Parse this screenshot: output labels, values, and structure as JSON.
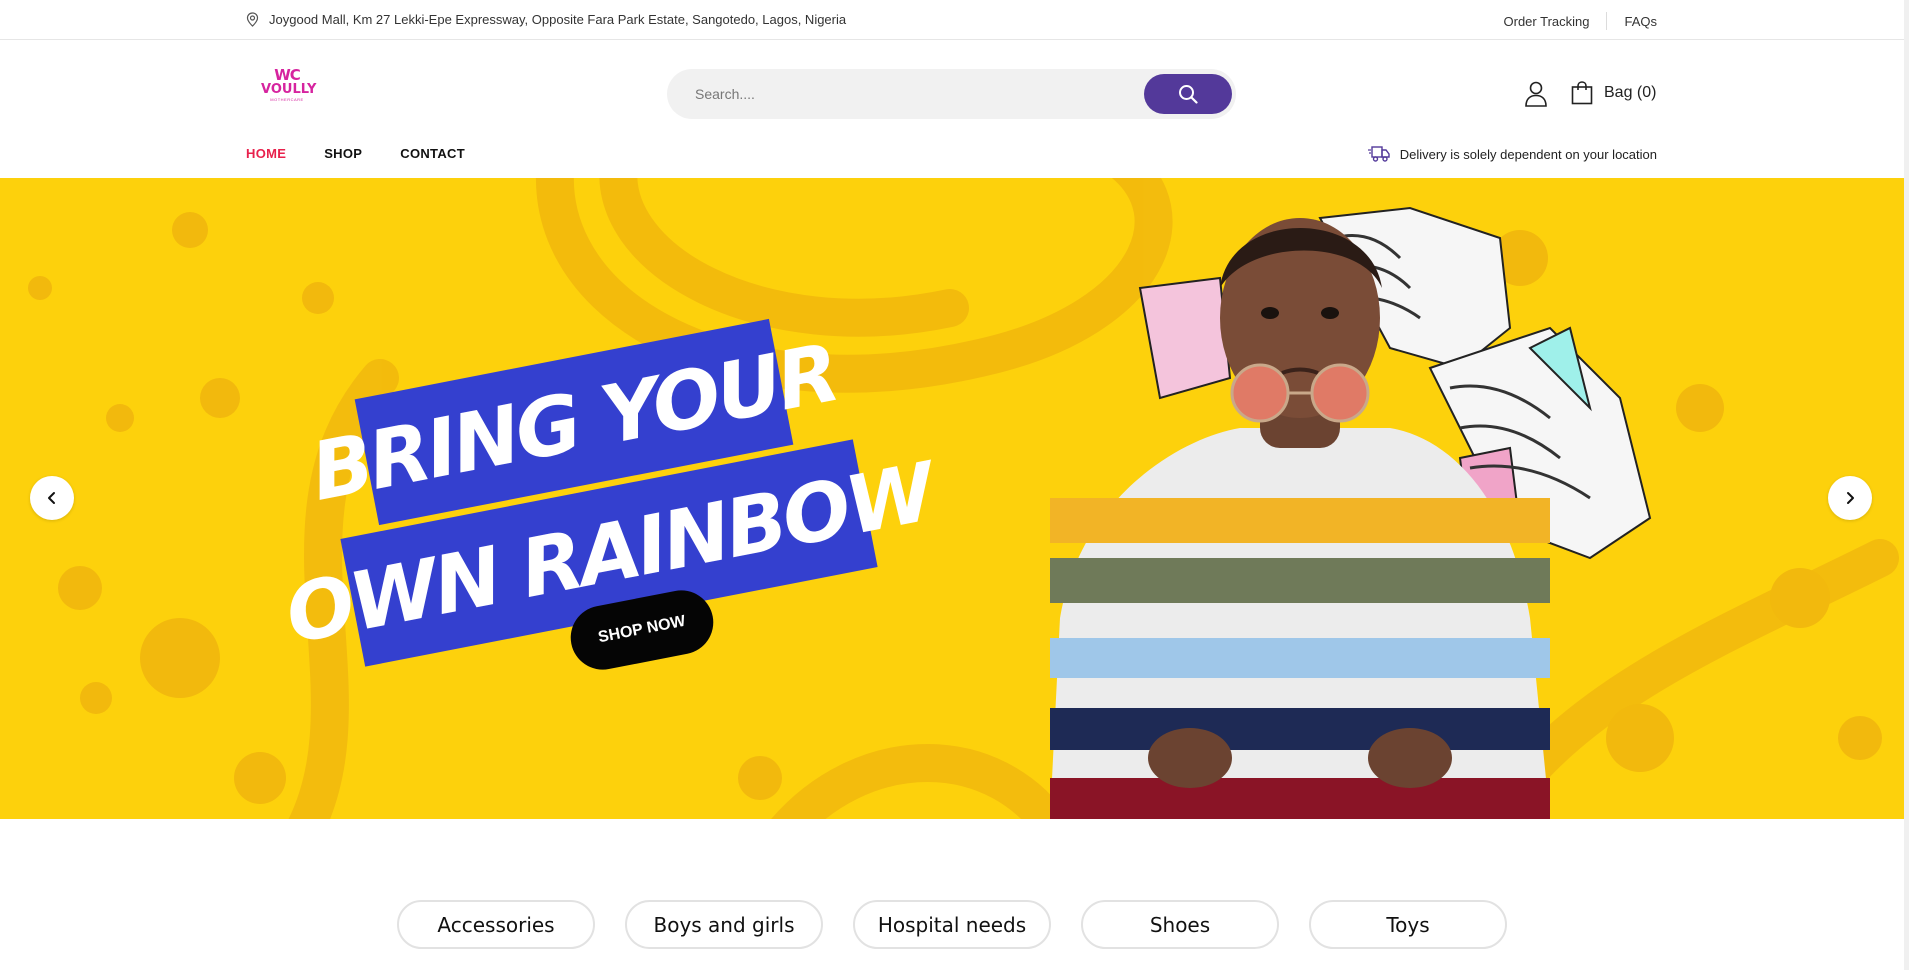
{
  "topbar": {
    "address": "Joygood Mall, Km 27 Lekki-Epe Expressway, Opposite Fara Park Estate, Sangotedo, Lagos, Nigeria",
    "order_tracking": "Order Tracking",
    "faqs": "FAQs"
  },
  "logo": {
    "monogram": "WC",
    "brand": "VOULLY",
    "tagline": "MOTHERCARE"
  },
  "search": {
    "placeholder": "Search...."
  },
  "header": {
    "bag_label": "Bag (0)"
  },
  "nav": {
    "items": [
      {
        "label": "HOME",
        "active": true
      },
      {
        "label": "SHOP",
        "active": false
      },
      {
        "label": "CONTACT",
        "active": false
      }
    ],
    "delivery_note": "Delivery is solely dependent on your location"
  },
  "hero": {
    "line1": "BRING YOUR",
    "line2": "OWN RAINBOW",
    "cta": "SHOP NOW",
    "background": "#fdd10c",
    "banner_color": "#3440cf"
  },
  "categories": [
    "Accessories",
    "Boys and girls",
    "Hospital needs",
    "Shoes",
    "Toys"
  ],
  "colors": {
    "accent": "#53399a",
    "active_nav": "#e8214c",
    "brand": "#d6249f"
  }
}
